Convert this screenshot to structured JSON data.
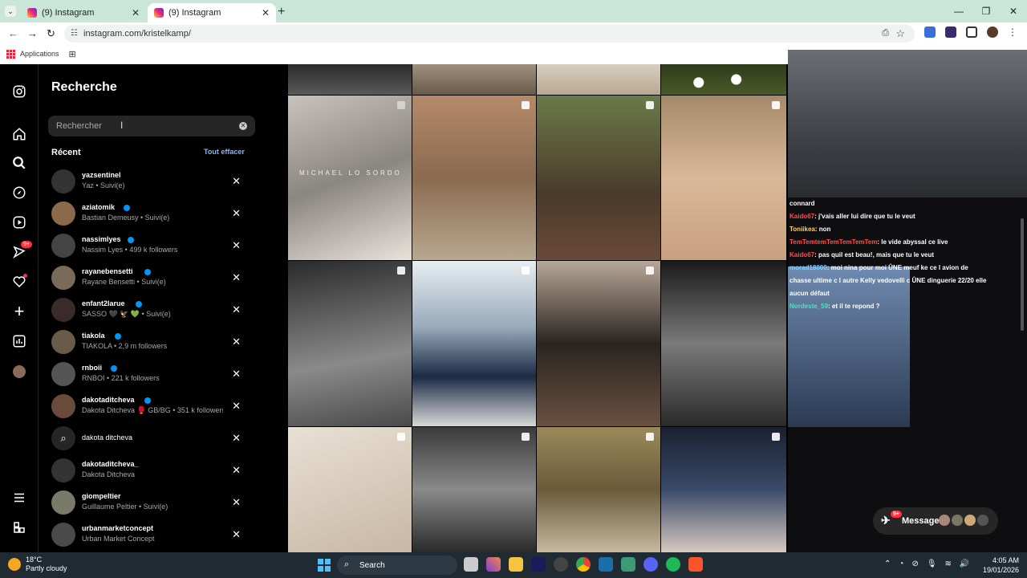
{
  "browser": {
    "tabs": [
      {
        "label": "(9) Instagram",
        "active": false
      },
      {
        "label": "(9) Instagram",
        "active": true
      }
    ],
    "url": "instagram.com/kristelkamp/",
    "bookmarks": {
      "apps_label": "Applications"
    }
  },
  "sidebar_badges": {
    "notifications": "9+"
  },
  "search_panel": {
    "title": "Recherche",
    "placeholder": "Rechercher",
    "recent_label": "Récent",
    "clear_all": "Tout effacer",
    "items": [
      {
        "name": "yazsentinel",
        "sub": "Yaz • Suivi(e)",
        "verified": false
      },
      {
        "name": "aziatomik",
        "sub": "Bastian Demeusy • Suivi(e)",
        "verified": true
      },
      {
        "name": "nassimlyes",
        "sub": "Nassim Lyes • 499 k followers",
        "verified": true
      },
      {
        "name": "rayanebensetti",
        "sub": "Rayane Bensetti • Suivi(e)",
        "verified": true
      },
      {
        "name": "enfant2larue",
        "sub": "SASSO 🖤 🦅 💚 • Suivi(e)",
        "verified": true
      },
      {
        "name": "tiakola",
        "sub": "TIAKOLA • 2,9 m followers",
        "verified": true
      },
      {
        "name": "rnboii",
        "sub": "RNBOI • 221 k followers",
        "verified": true
      },
      {
        "name": "dakotaditcheva",
        "sub": "Dakota Ditcheva 🥊 GB/BG • 351 k followers",
        "verified": true
      },
      {
        "name": "dakota ditcheva",
        "sub": "",
        "verified": false,
        "is_query": true
      },
      {
        "name": "dakotaditcheva_",
        "sub": "Dakota Ditcheva",
        "verified": false
      },
      {
        "name": "giompeltier",
        "sub": "Guillaume Peltier • Suivi(e)",
        "verified": false
      },
      {
        "name": "urbanmarketconcept",
        "sub": "Urban Market Concept",
        "verified": false
      }
    ]
  },
  "feed": {
    "watermark": "MICHAEL LO SORDO"
  },
  "chat": {
    "lines": [
      {
        "user": "connard",
        "text": "",
        "color": "#ffffff"
      },
      {
        "user": "Kaido67",
        "text": ": j'vais aller lui dire que tu le veut",
        "color": "#ff4f4f"
      },
      {
        "user": "Toniikea",
        "text": ": non",
        "color": "#ffd35a"
      },
      {
        "user": "TemTemtemTemTemTemTem",
        "text": ": le vide abyssal ce live",
        "color": "#ff4f4f"
      },
      {
        "user": "Kaido67",
        "text": ": pas quil est beau!, mais que tu le veut",
        "color": "#ff4f4f"
      },
      {
        "user": "morad18000",
        "text": ": moi nina pour moi ÛNE meuf ke ce l avion de",
        "color": "#7fd0ff"
      },
      {
        "user": "",
        "text": "chasse ultime c l autre Kelly vedovelli c ÛNE dinguerie 22/20 elle",
        "color": "#ffffff"
      },
      {
        "user": "",
        "text": "aucun défaut",
        "color": "#ffffff"
      },
      {
        "user": "Nordeste_59",
        "text": ": et il te repond ?",
        "color": "#4fe0c0"
      }
    ]
  },
  "messages": {
    "label": "Messages",
    "badge": "9+"
  },
  "taskbar": {
    "temp": "18°C",
    "weather": "Partly cloudy",
    "search": "Search",
    "time": "4:05 AM",
    "date": "19/01/2026"
  }
}
